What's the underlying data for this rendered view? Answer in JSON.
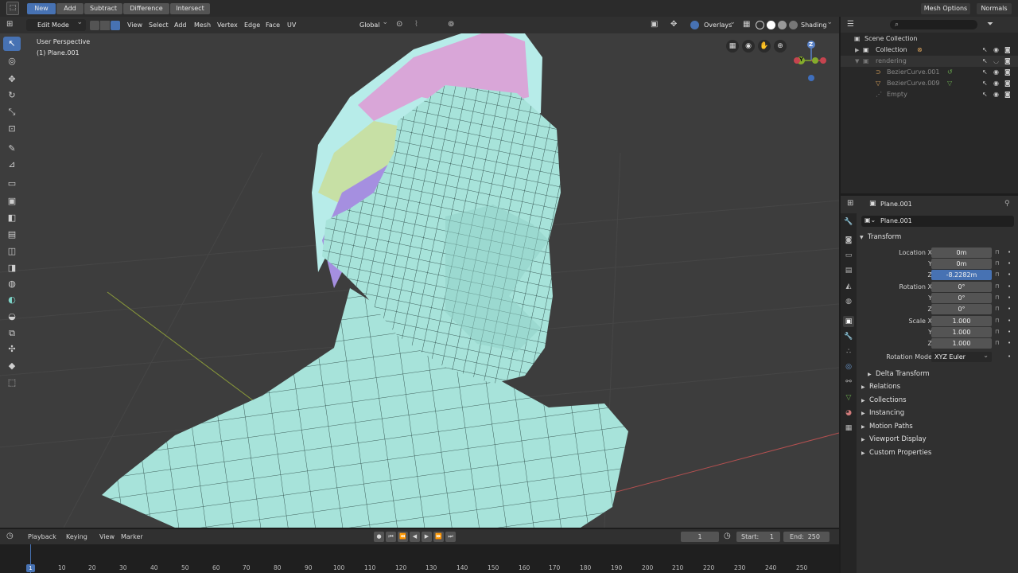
{
  "topbar": {
    "tools": [
      "New",
      "Add",
      "Subtract",
      "Difference",
      "Intersect"
    ],
    "mesh_options": "Mesh Options",
    "normals": "Normals"
  },
  "header": {
    "mode": "Edit Mode",
    "menus": [
      "View",
      "Select",
      "Add",
      "Mesh",
      "Vertex",
      "Edge",
      "Face",
      "UV"
    ],
    "orientation": "Global",
    "overlays": "Overlays",
    "shading": "Shading"
  },
  "viewport": {
    "view_name": "User Perspective",
    "object_name": "(1) Plane.001",
    "gizmo_z": "Z",
    "gizmo_y": "Y"
  },
  "outliner": {
    "scene_collection": "Scene Collection",
    "collection": "Collection",
    "rendering": "rendering",
    "items": [
      "BezierCurve.001",
      "BezierCurve.009",
      "Empty"
    ]
  },
  "properties": {
    "object": "Plane.001",
    "object_field": "Plane.001",
    "transform": "Transform",
    "location_label": "Location X",
    "rotation_label": "Rotation X",
    "scale_label": "Scale X",
    "y": "Y",
    "z": "Z",
    "location": [
      "0m",
      "0m",
      "-8.2282m"
    ],
    "rotation": [
      "0°",
      "0°",
      "0°"
    ],
    "scale": [
      "1.000",
      "1.000",
      "1.000"
    ],
    "rotation_mode_label": "Rotation Mode",
    "rotation_mode": "XYZ Euler",
    "delta": "Delta Transform",
    "sections": [
      "Relations",
      "Collections",
      "Instancing",
      "Motion Paths",
      "Viewport Display",
      "Custom Properties"
    ]
  },
  "timeline": {
    "menus": [
      "Playback",
      "Keying",
      "View",
      "Marker"
    ],
    "current_frame": "1",
    "start_label": "Start:",
    "start": "1",
    "end_label": "End:",
    "end": "250",
    "ruler": [
      "1",
      "10",
      "20",
      "30",
      "40",
      "50",
      "60",
      "70",
      "80",
      "90",
      "100",
      "110",
      "120",
      "130",
      "140",
      "150",
      "160",
      "170",
      "180",
      "190",
      "200",
      "210",
      "220",
      "230",
      "240",
      "250"
    ]
  },
  "colors": {
    "accent": "#4772b3",
    "mesh": "#a7e3da",
    "wire": "#1f3a38",
    "hair_pink": "#d9a6d8",
    "hair_purple": "#a58fe0",
    "hair_green": "#c7e0a5",
    "hair_cyan": "#b7ece9"
  }
}
